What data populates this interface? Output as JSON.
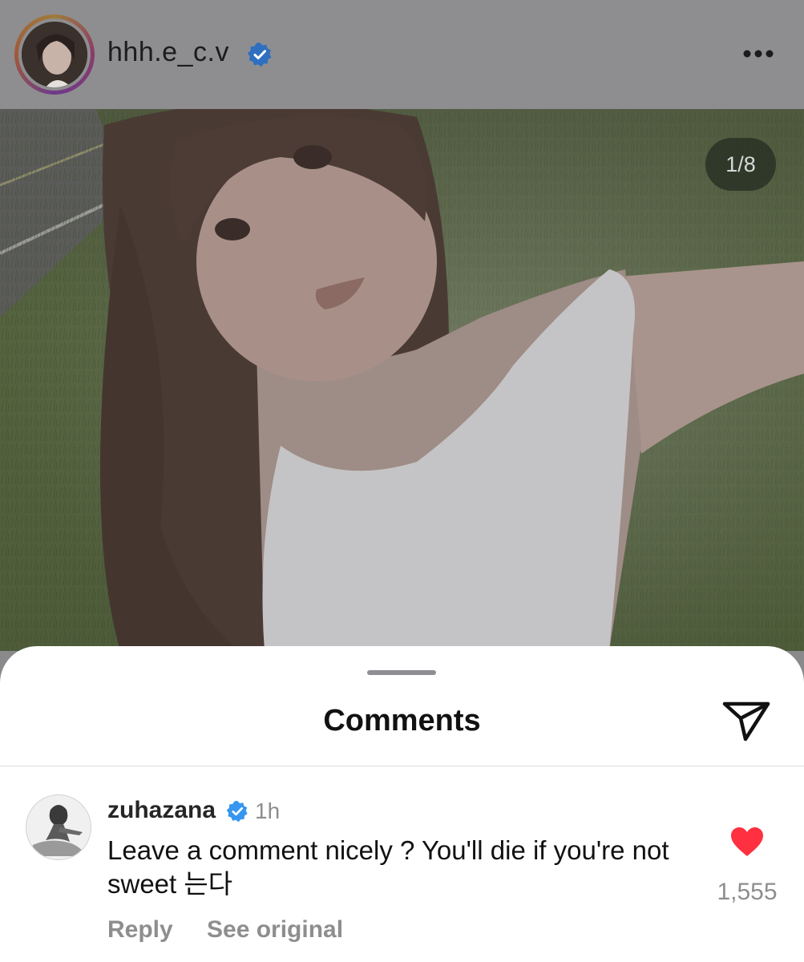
{
  "post": {
    "username": "hhh.e_c.v",
    "verified": true,
    "page_counter": "1/8"
  },
  "comments_sheet": {
    "title": "Comments",
    "comment": {
      "username": "zuhazana",
      "verified": true,
      "time": "1h",
      "text": "Leave a comment nicely ? You'll die if you're not sweet 는다",
      "liked": true,
      "like_count": "1,555",
      "reply_label": "Reply",
      "see_original_label": "See original"
    }
  },
  "colors": {
    "verified_blue": "#3797f0",
    "heart_red": "#ff3040",
    "muted_text": "#8e8e8e"
  },
  "icons": {
    "verified": "verified-badge-icon",
    "more": "more-horizontal-icon",
    "share": "paper-plane-icon",
    "like": "heart-filled-icon"
  }
}
